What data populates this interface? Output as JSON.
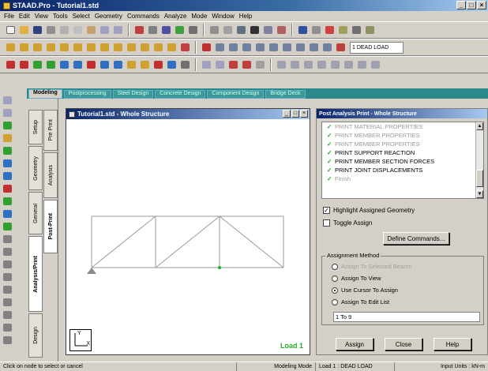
{
  "window": {
    "title": "STAAD.Pro - Tutorial1.std"
  },
  "menu": [
    "File",
    "Edit",
    "View",
    "Tools",
    "Select",
    "Geometry",
    "Commands",
    "Analyze",
    "Mode",
    "Window",
    "Help"
  ],
  "toolbar": {
    "load_case": "1 DEAD LOAD"
  },
  "page_tabs": [
    "Modeling",
    "Postprocessing",
    "Steel Design",
    "Concrete Design",
    "Component Design",
    "Bridge Deck"
  ],
  "side_tabs": {
    "group1": [
      "Setup",
      "Geometry",
      "General",
      "Analysis/Print",
      "Design"
    ],
    "group2": [
      "Pre Print",
      "Analysis",
      "Post-Print"
    ]
  },
  "structure_window": {
    "title": "Tutorial1.std - Whole Structure",
    "load_label": "Load 1",
    "axis": {
      "y": "Y",
      "x": "X"
    }
  },
  "panel": {
    "title": "Post Analysis Print - Whole Structure",
    "commands": [
      {
        "label": "PRINT MATERIAL PROPERTIES",
        "state": "dim"
      },
      {
        "label": "PRINT MEMBER PROPERTIES",
        "state": "dim"
      },
      {
        "label": "PRINT MEMBER PROPERTIES",
        "state": "dim"
      },
      {
        "label": "PRINT SUPPORT REACTION",
        "state": "bold"
      },
      {
        "label": "PRINT MEMBER SECTION FORCES",
        "state": "bold"
      },
      {
        "label": "PRINT JOINT DISPLACEMENTS",
        "state": "bold"
      },
      {
        "label": "Finish",
        "state": "dim"
      }
    ],
    "highlight_label": "Highlight Assigned Geometry",
    "highlight_checked": true,
    "toggle_label": "Toggle Assign",
    "toggle_checked": false,
    "define_button": "Define Commands...",
    "assignment_method_title": "Assignment Method",
    "assignment_options": [
      {
        "label": "Assign To Selected Beams",
        "selected": false,
        "enabled": false
      },
      {
        "label": "Assign To View",
        "selected": false,
        "enabled": true
      },
      {
        "label": "Use Cursor To Assign",
        "selected": true,
        "enabled": true
      },
      {
        "label": "Assign To Edit List",
        "selected": false,
        "enabled": true
      }
    ],
    "edit_list_value": "1 To 9",
    "assign_button": "Assign",
    "close_button": "Close",
    "help_button": "Help"
  },
  "status": {
    "hint": "Click on node to select or cancel",
    "mode": "Modeling Mode",
    "load": "Load 1 : DEAD LOAD",
    "units": "Input Units : kN-m"
  }
}
